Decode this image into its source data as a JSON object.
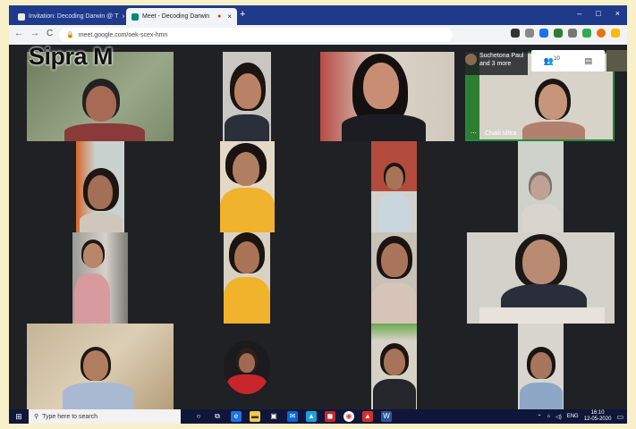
{
  "browser": {
    "tabs": [
      {
        "label": "Invitation: Decoding Darwin @ T",
        "close": "×"
      },
      {
        "label": "Meet - Decoding Darwin",
        "close": "×"
      }
    ],
    "new_tab": "+",
    "window_controls": [
      "–",
      "□",
      "×"
    ],
    "nav": [
      "←",
      "→",
      "C"
    ],
    "url": "meet.google.com/oek-scex-hmn"
  },
  "meet": {
    "speaker_name": "Sipra M",
    "notification": {
      "line1": "Suchetona Paul",
      "line2": "and 3 more"
    },
    "top_controls": {
      "people_count": "10",
      "chat_icon": "chat-icon"
    },
    "tile_label": "Chaiti Mitra",
    "more_dots": "⋯"
  },
  "taskbar": {
    "start": "⊞",
    "search_placeholder": "Type here to search",
    "language": "ENG",
    "time": "16:10",
    "date": "12-05-2020"
  },
  "colors": {
    "tab_bar": "#1f3a8a",
    "meet_bg": "#202124",
    "taskbar": "#10163a",
    "speaker_border": "#1e8e3e"
  }
}
